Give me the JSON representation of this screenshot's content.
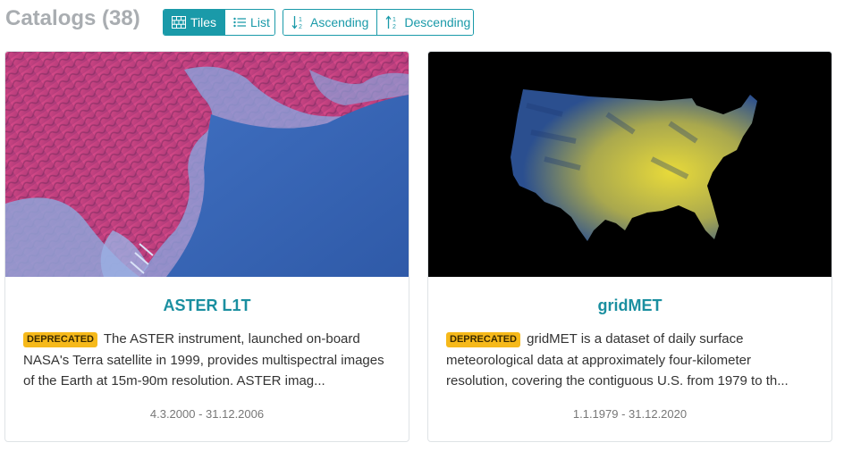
{
  "header": {
    "title": "Catalogs (38)",
    "view_buttons": [
      {
        "label": "Tiles",
        "icon": "tiles-icon",
        "active": true
      },
      {
        "label": "List",
        "icon": "list-icon",
        "active": false
      }
    ],
    "sort_buttons": [
      {
        "label": "Ascending",
        "icon": "sort-ascending-icon"
      },
      {
        "label": "Descending",
        "icon": "sort-descending-icon"
      }
    ]
  },
  "cards": [
    {
      "title": "ASTER L1T",
      "badge": "DEPRECATED",
      "description": "The ASTER instrument, launched on-board NASA's Terra satellite in 1999, provides multispectral images of the Earth at 15m-90m resolution. ASTER imag...",
      "dates": "4.3.2000 - 31.12.2006",
      "thumbnail": "false-color satellite image of coastline"
    },
    {
      "title": "gridMET",
      "badge": "DEPRECATED",
      "description": "gridMET is a dataset of daily surface meteorological data at approximately four-kilometer resolution, covering the contiguous U.S. from 1979 to th...",
      "dates": "1.1.1979 - 31.12.2020",
      "thumbnail": "map of contiguous United States"
    }
  ],
  "colors": {
    "accent": "#1a9aa9",
    "badge": "#f6b91a",
    "title_gray": "#a9adb1"
  }
}
